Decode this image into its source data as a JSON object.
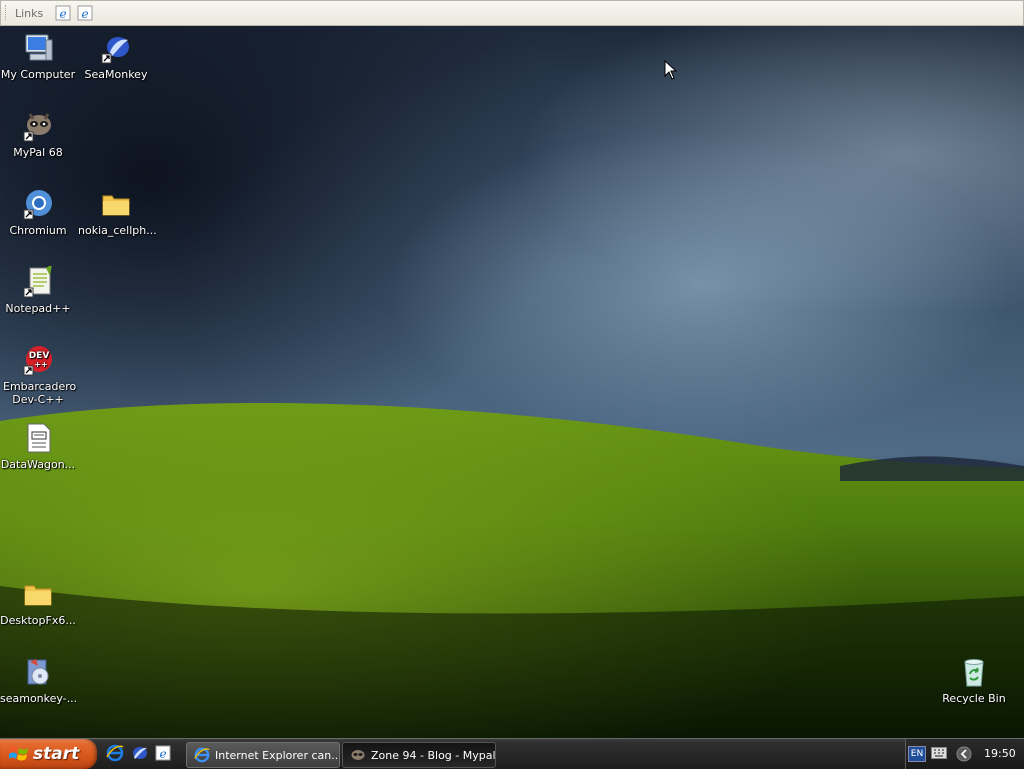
{
  "links_bar": {
    "label": "Links"
  },
  "desktop_icons": [
    {
      "label": "My Computer"
    },
    {
      "label": "SeaMonkey"
    },
    {
      "label": "MyPal 68"
    },
    {
      "label": "Chromium"
    },
    {
      "label": "nokia_cellph..."
    },
    {
      "label": "Notepad++"
    },
    {
      "label": "Embarcadero Dev-C++"
    },
    {
      "label": "DataWagon..."
    },
    {
      "label": "DesktopFx6..."
    },
    {
      "label": "seamonkey-..."
    },
    {
      "label": "Recycle Bin"
    }
  ],
  "taskbar": {
    "start_label": "start",
    "tasks": [
      {
        "label": "Internet Explorer can..."
      },
      {
        "label": "Zone 94 - Blog - Mypal"
      }
    ],
    "tray": {
      "language": "EN",
      "clock": "19:50"
    }
  },
  "colors": {
    "start_orange": "#d5561a",
    "taskbar": "#262626"
  }
}
